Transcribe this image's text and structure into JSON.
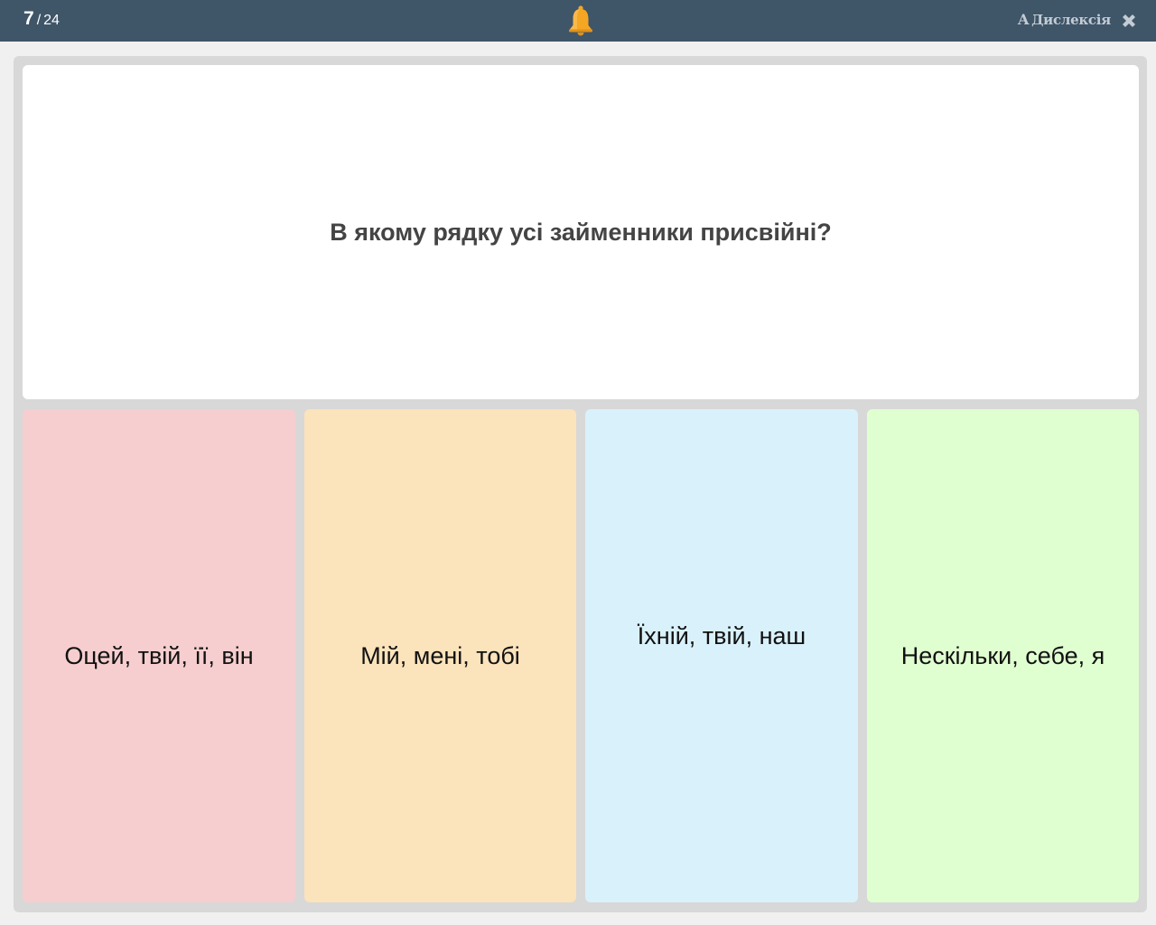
{
  "header": {
    "current": "7",
    "separator": "/",
    "total": "24",
    "bell_icon": "bell-icon",
    "dyslexia_letter": "A",
    "dyslexia_label": "Дислексія",
    "close_icon": "close-icon"
  },
  "question": {
    "text": "В якому рядку усі займенники присвійні?"
  },
  "answers": [
    {
      "label": "Оцей, твій, її, він",
      "color": "#f6cecf"
    },
    {
      "label": "Мій, мені, тобі",
      "color": "#fbe3bb"
    },
    {
      "label": "Їхній, твій, наш",
      "color": "#d9f1fa"
    },
    {
      "label": "Нескільки, себе, я",
      "color": "#e0ffd1"
    }
  ],
  "colors": {
    "topbar": "#3f5568",
    "bell": "#f5a623",
    "board": "#d8d8d8"
  }
}
